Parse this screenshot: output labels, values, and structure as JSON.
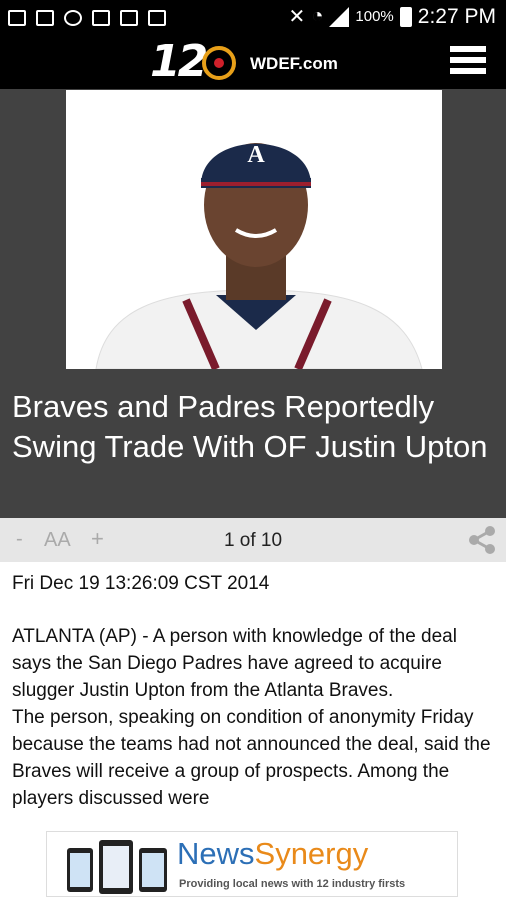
{
  "status_bar": {
    "battery": "100%",
    "time": "2:27 PM"
  },
  "header": {
    "logo_number": "12",
    "site": "WDEF.com"
  },
  "article": {
    "headline": "Braves and Padres Reportedly Swing Trade With OF Justin Upton",
    "date": "Fri Dec 19 13:26:09 CST 2014",
    "body": "ATLANTA (AP) - A person with knowledge of the deal says the San Diego Padres have agreed to acquire slugger Justin Upton from the Atlanta Braves.\nThe person, speaking on condition of anonymity Friday because the teams had not announced the deal, said the Braves will receive a group of prospects. Among the players discussed were"
  },
  "toolbar": {
    "minus": "-",
    "text_size": "AA",
    "plus": "+",
    "page_indicator": "1 of 10"
  },
  "ad": {
    "brand_a": "News",
    "brand_b": "Synergy",
    "tagline": "Providing local news with 12 industry firsts"
  },
  "colors": {
    "status_bg": "#000000",
    "hero_bg": "#424242",
    "toolbar_bg": "#e6e6e6",
    "brand_blue": "#2c6fb6",
    "brand_orange": "#e98a1a",
    "logo_orange": "#e8a019",
    "logo_red": "#d0202a"
  }
}
